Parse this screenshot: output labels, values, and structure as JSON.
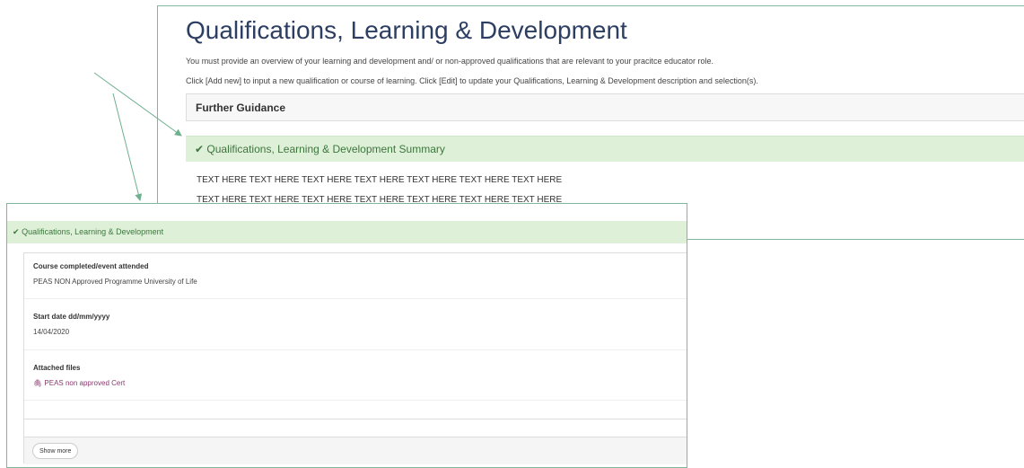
{
  "back": {
    "title": "Qualifications, Learning & Development",
    "intro_line_1": "You must provide an overview of your learning and development and/ or non-approved qualifications that are relevant to your pracitce educator role.",
    "intro_line_2": "Click [Add new] to input a new qualification or course of learning.  Click [Edit] to update your Qualifications, Learning & Development description and selection(s).",
    "guidance_label": "Further Guidance",
    "summary_heading": "Qualifications, Learning & Development Summary",
    "summary_line_1": "TEXT HERE TEXT HERE TEXT HERE TEXT HERE TEXT HERE TEXT HERE TEXT HERE",
    "summary_line_2": "TEXT HERE TEXT HERE TEXT HERE TEXT HERE TEXT HERE TEXT HERE TEXT HERE"
  },
  "front": {
    "heading": "Qualifications, Learning & Development",
    "fields": [
      {
        "label": "Course completed/event attended",
        "value": "PEAS NON Approved Programme University of Life"
      },
      {
        "label": "Start date dd/mm/yyyy",
        "value": "14/04/2020"
      },
      {
        "label": "Attached files",
        "value": "PEAS non approved Cert"
      }
    ],
    "show_more_label": "Show more"
  },
  "icons": {
    "check": "check-icon",
    "attachment": "paperclip-icon"
  },
  "colors": {
    "accent_green": "#3c763d",
    "bar_green": "#dff0d8",
    "border_green": "#7fb79a",
    "title_navy": "#2c3e62",
    "link_purple": "#8a3a6e"
  }
}
